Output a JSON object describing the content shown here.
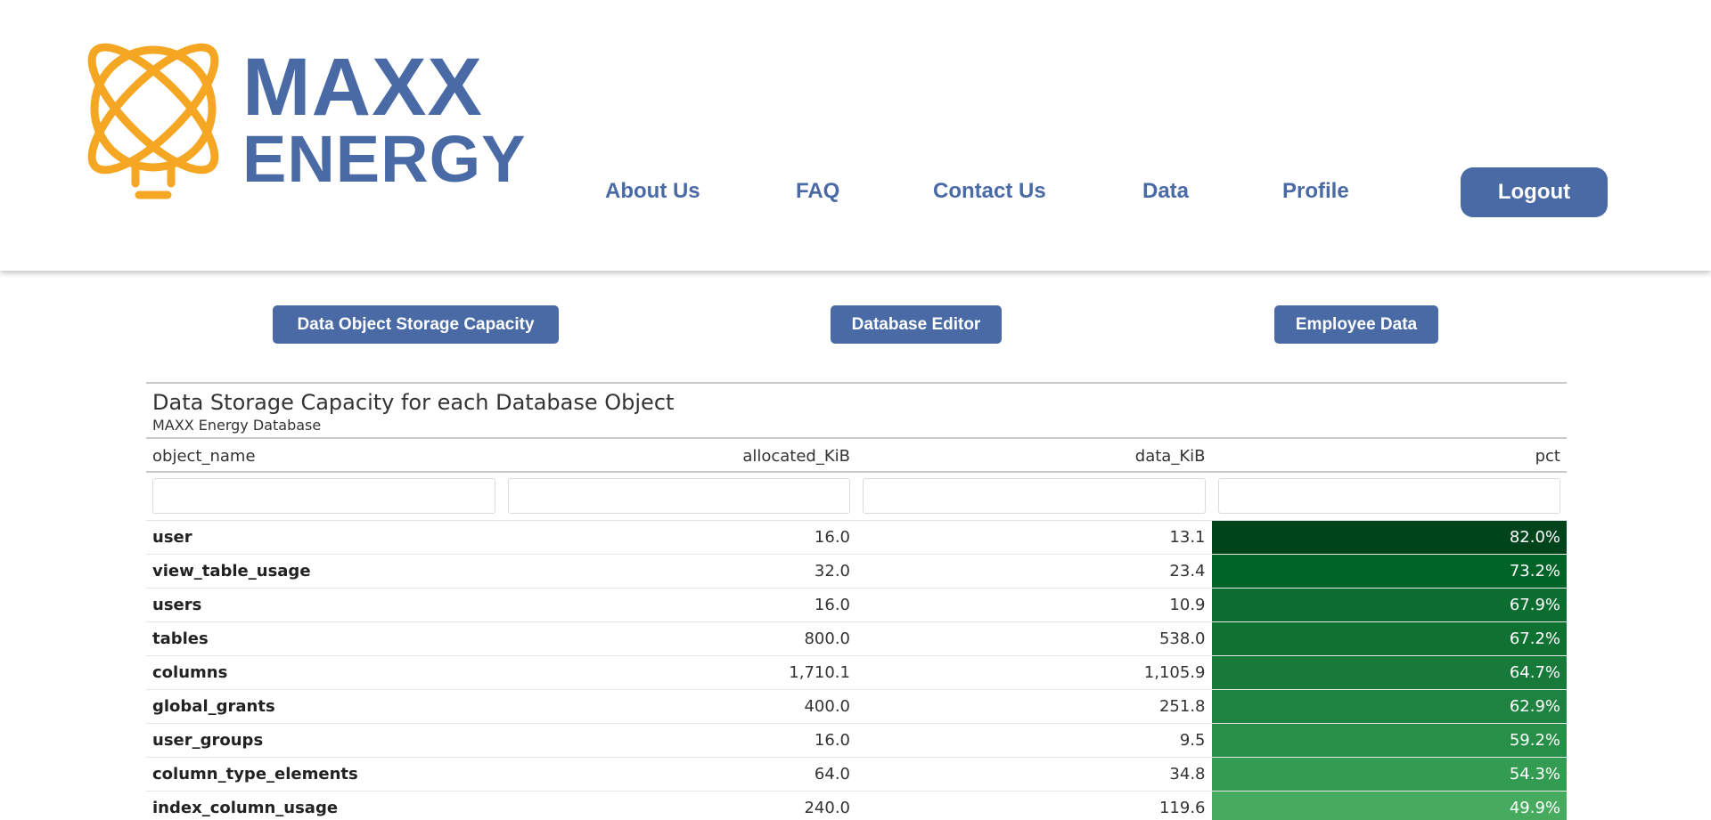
{
  "brand": {
    "line1": "MAXX",
    "line2": "ENERGY",
    "text_color": "#4a6aa5",
    "icon_color": "#f5a623"
  },
  "nav": {
    "about": "About Us",
    "faq": "FAQ",
    "contact": "Contact Us",
    "data": "Data",
    "profile": "Profile",
    "logout": "Logout"
  },
  "subnav": {
    "storage": "Data Object Storage Capacity",
    "editor": "Database Editor",
    "employee": "Employee Data"
  },
  "table": {
    "title": "Data Storage Capacity for each Database Object",
    "subtitle": "MAXX Energy Database",
    "columns": [
      "object_name",
      "allocated_KiB",
      "data_KiB",
      "pct"
    ],
    "rows": [
      {
        "object_name": "user",
        "allocated_KiB": "16.0",
        "data_KiB": "13.1",
        "pct": "82.0%",
        "pct_value": 82.0,
        "color": "#00441b"
      },
      {
        "object_name": "view_table_usage",
        "allocated_KiB": "32.0",
        "data_KiB": "23.4",
        "pct": "73.2%",
        "pct_value": 73.2,
        "color": "#006428"
      },
      {
        "object_name": "users",
        "allocated_KiB": "16.0",
        "data_KiB": "10.9",
        "pct": "67.9%",
        "pct_value": 67.9,
        "color": "#0b6e30"
      },
      {
        "object_name": "tables",
        "allocated_KiB": "800.0",
        "data_KiB": "538.0",
        "pct": "67.2%",
        "pct_value": 67.2,
        "color": "#0f7233"
      },
      {
        "object_name": "columns",
        "allocated_KiB": "1,710.1",
        "data_KiB": "1,105.9",
        "pct": "64.7%",
        "pct_value": 64.7,
        "color": "#17793a"
      },
      {
        "object_name": "global_grants",
        "allocated_KiB": "400.0",
        "data_KiB": "251.8",
        "pct": "62.9%",
        "pct_value": 62.9,
        "color": "#1e8340"
      },
      {
        "object_name": "user_groups",
        "allocated_KiB": "16.0",
        "data_KiB": "9.5",
        "pct": "59.2%",
        "pct_value": 59.2,
        "color": "#278f48"
      },
      {
        "object_name": "column_type_elements",
        "allocated_KiB": "64.0",
        "data_KiB": "34.8",
        "pct": "54.3%",
        "pct_value": 54.3,
        "color": "#339c52"
      },
      {
        "object_name": "index_column_usage",
        "allocated_KiB": "240.0",
        "data_KiB": "119.6",
        "pct": "49.9%",
        "pct_value": 49.9,
        "color": "#46ab5e"
      }
    ]
  }
}
